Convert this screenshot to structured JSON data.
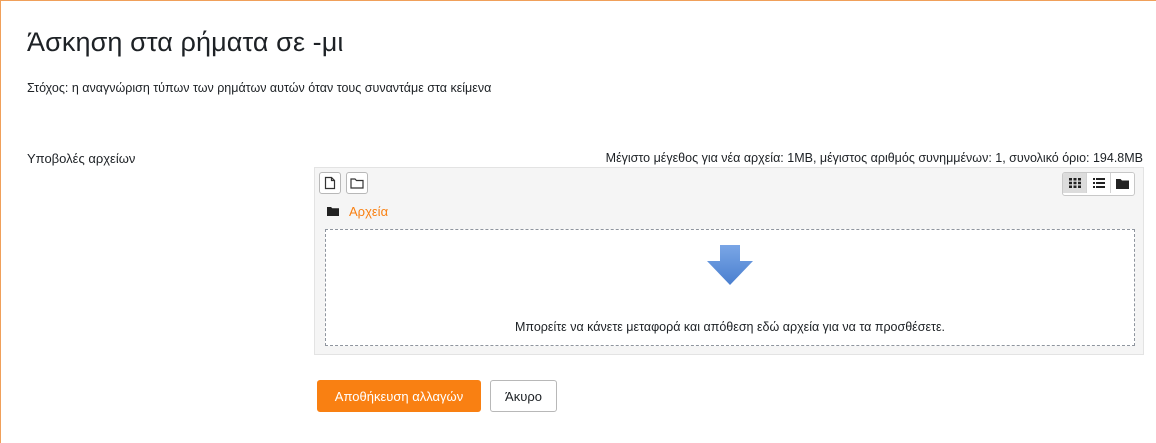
{
  "page": {
    "title": "Άσκηση στα ρήματα σε -μι",
    "intro": "Στόχος: η αναγνώριση τύπων των ρημάτων αυτών όταν τους συναντάμε στα κείμενα"
  },
  "form": {
    "field_label": "Υποβολές αρχείων",
    "limits_text": "Μέγιστο μέγεθος για νέα αρχεία: 1MB, μέγιστος αριθμός συνημμένων: 1, συνολικό όριο: 194.8MB"
  },
  "filemanager": {
    "toolbar": {
      "add_file_icon": "file-icon",
      "create_folder_icon": "folder-outline-icon"
    },
    "views": [
      {
        "icon": "grid-icon",
        "active": true
      },
      {
        "icon": "list-icon",
        "active": false
      },
      {
        "icon": "folder-tree-icon",
        "active": false
      }
    ],
    "path_label": "Αρχεία",
    "dropzone_text": "Μπορείτε να κάνετε μεταφορά και απόθεση εδώ αρχεία για να τα προσθέσετε."
  },
  "actions": {
    "save_label": "Αποθήκευση αλλαγών",
    "cancel_label": "Άκυρο"
  },
  "colors": {
    "accent": "#f98012",
    "frame_border": "#f0a05a",
    "drop_arrow": "#5b8fd6"
  }
}
